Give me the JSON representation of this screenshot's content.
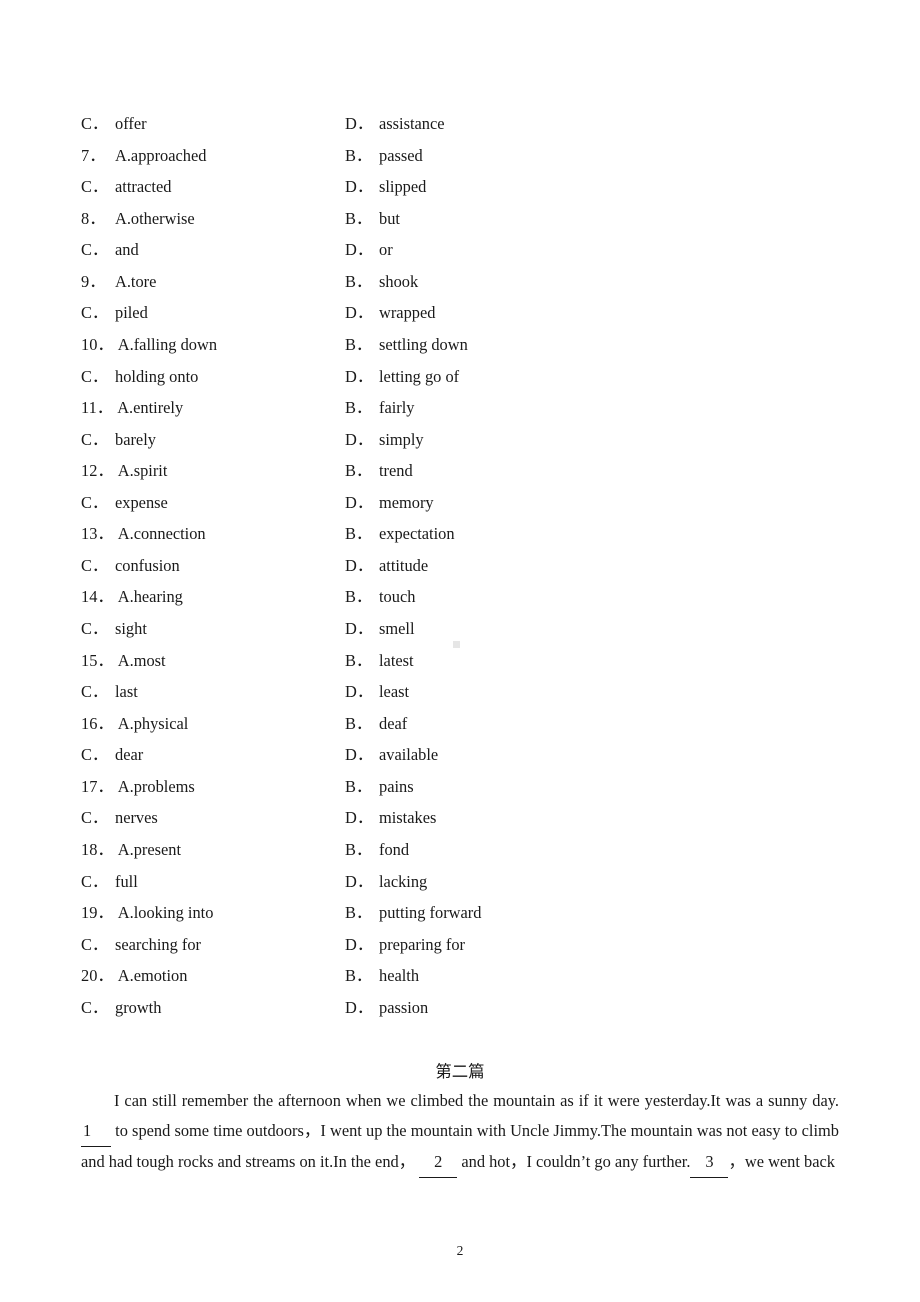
{
  "document": {
    "page_number": "2"
  },
  "options_block": {
    "rows": [
      {
        "left": {
          "tag": "C．",
          "text": "offer"
        },
        "right": {
          "tag": "D．",
          "text": "assistance"
        }
      },
      {
        "left": {
          "tag": "7．",
          "text": "A.approached"
        },
        "right": {
          "tag": "B．",
          "text": "passed"
        }
      },
      {
        "left": {
          "tag": "C．",
          "text": "attracted"
        },
        "right": {
          "tag": "D．",
          "text": "slipped"
        }
      },
      {
        "left": {
          "tag": "8．",
          "text": "A.otherwise"
        },
        "right": {
          "tag": "B．",
          "text": "but"
        }
      },
      {
        "left": {
          "tag": "C．",
          "text": "and"
        },
        "right": {
          "tag": "D．",
          "text": "or"
        }
      },
      {
        "left": {
          "tag": "9．",
          "text": "A.tore"
        },
        "right": {
          "tag": "B．",
          "text": "shook"
        }
      },
      {
        "left": {
          "tag": "C．",
          "text": "piled"
        },
        "right": {
          "tag": "D．",
          "text": "wrapped"
        }
      },
      {
        "left": {
          "tag": "10．",
          "text": "A.falling down"
        },
        "right": {
          "tag": "B．",
          "text": "settling down"
        }
      },
      {
        "left": {
          "tag": "C．",
          "text": "holding onto"
        },
        "right": {
          "tag": "D．",
          "text": "letting go of"
        }
      },
      {
        "left": {
          "tag": "11．",
          "text": "A.entirely"
        },
        "right": {
          "tag": "B．",
          "text": "fairly"
        }
      },
      {
        "left": {
          "tag": "C．",
          "text": "barely"
        },
        "right": {
          "tag": "D．",
          "text": "simply"
        }
      },
      {
        "left": {
          "tag": "12．",
          "text": "A.spirit"
        },
        "right": {
          "tag": "B．",
          "text": "trend"
        }
      },
      {
        "left": {
          "tag": "C．",
          "text": "expense"
        },
        "right": {
          "tag": "D．",
          "text": "memory"
        }
      },
      {
        "left": {
          "tag": "13．",
          "text": "A.connection"
        },
        "right": {
          "tag": "B．",
          "text": "expectation"
        }
      },
      {
        "left": {
          "tag": "C．",
          "text": "confusion"
        },
        "right": {
          "tag": "D．",
          "text": "attitude"
        }
      },
      {
        "left": {
          "tag": "14．",
          "text": "A.hearing"
        },
        "right": {
          "tag": "B．",
          "text": "touch"
        }
      },
      {
        "left": {
          "tag": "C．",
          "text": "sight"
        },
        "right": {
          "tag": "D．",
          "text": "smell"
        }
      },
      {
        "left": {
          "tag": "15．",
          "text": "A.most"
        },
        "right": {
          "tag": "B．",
          "text": "latest"
        }
      },
      {
        "left": {
          "tag": "C．",
          "text": "last"
        },
        "right": {
          "tag": "D．",
          "text": "least"
        }
      },
      {
        "left": {
          "tag": "16．",
          "text": "A.physical"
        },
        "right": {
          "tag": "B．",
          "text": "deaf"
        }
      },
      {
        "left": {
          "tag": "C．",
          "text": "dear"
        },
        "right": {
          "tag": "D．",
          "text": "available"
        }
      },
      {
        "left": {
          "tag": "17．",
          "text": "A.problems"
        },
        "right": {
          "tag": "B．",
          "text": "pains"
        }
      },
      {
        "left": {
          "tag": "C．",
          "text": "nerves"
        },
        "right": {
          "tag": "D．",
          "text": "mistakes"
        }
      },
      {
        "left": {
          "tag": "18．",
          "text": "A.present"
        },
        "right": {
          "tag": "B．",
          "text": "fond"
        }
      },
      {
        "left": {
          "tag": "C．",
          "text": "full"
        },
        "right": {
          "tag": "D．",
          "text": "lacking"
        }
      },
      {
        "left": {
          "tag": "19．",
          "text": "A.looking into"
        },
        "right": {
          "tag": "B．",
          "text": "putting forward"
        }
      },
      {
        "left": {
          "tag": "C．",
          "text": "searching for"
        },
        "right": {
          "tag": "D．",
          "text": "preparing for"
        }
      },
      {
        "left": {
          "tag": "20．",
          "text": "A.emotion"
        },
        "right": {
          "tag": "B．",
          "text": "health"
        }
      },
      {
        "left": {
          "tag": "C．",
          "text": "growth"
        },
        "right": {
          "tag": "D．",
          "text": "passion"
        }
      }
    ]
  },
  "passage": {
    "heading": "第二篇",
    "part1": "I can still remember the afternoon when we climbed the mountain as if it were yesterday.It was a sunny day.",
    "blank1": "1",
    "part2": "to spend some time outdoors，I went up the mountain with Uncle Jimmy.The mountain was not easy to climb and had tough rocks and streams on it.In the end，",
    "blank2": "2",
    "part3": "and hot，I couldn’t go any further.",
    "blank3": "3",
    "part4": "，we went back"
  }
}
